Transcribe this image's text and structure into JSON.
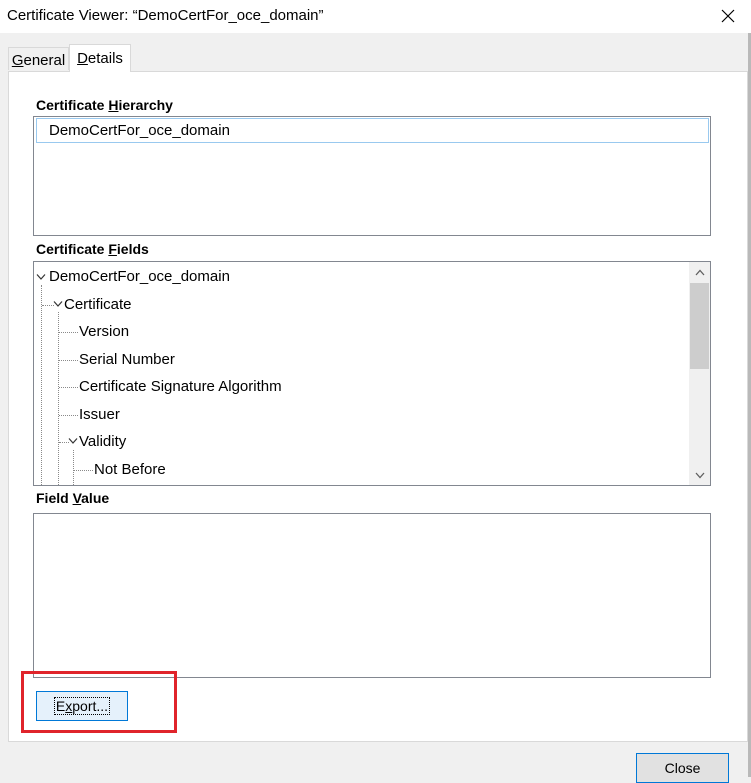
{
  "window": {
    "title": "Certificate Viewer: “DemoCertFor_oce_domain”",
    "close_glyph": "✕"
  },
  "tabs": [
    {
      "label": "General",
      "mnemonic": "G",
      "selected": false
    },
    {
      "label": "Details",
      "mnemonic": "D",
      "selected": true
    }
  ],
  "hierarchy": {
    "label_pre": "Certificate ",
    "label_key": "H",
    "label_post": "ierarchy",
    "items": [
      "DemoCertFor_oce_domain"
    ]
  },
  "fields": {
    "label_pre": "Certificate ",
    "label_key": "F",
    "label_post": "ields",
    "tree": [
      {
        "text": "DemoCertFor_oce_domain",
        "level": 0,
        "expanded": true
      },
      {
        "text": "Certificate",
        "level": 1,
        "expanded": true
      },
      {
        "text": "Version",
        "level": 2
      },
      {
        "text": "Serial Number",
        "level": 2
      },
      {
        "text": "Certificate Signature Algorithm",
        "level": 2
      },
      {
        "text": "Issuer",
        "level": 2
      },
      {
        "text": "Validity",
        "level": 2,
        "expanded": true
      },
      {
        "text": "Not Before",
        "level": 3
      }
    ]
  },
  "field_value": {
    "label_pre": "Field ",
    "label_key": "V",
    "label_post": "alue",
    "content": ""
  },
  "buttons": {
    "export_key": "x",
    "export_pre": "E",
    "export_post": "port...",
    "close": "Close"
  },
  "colors": {
    "highlight": "#e0242b",
    "focus_border": "#0078d7",
    "selection_border": "#99c9ef"
  }
}
